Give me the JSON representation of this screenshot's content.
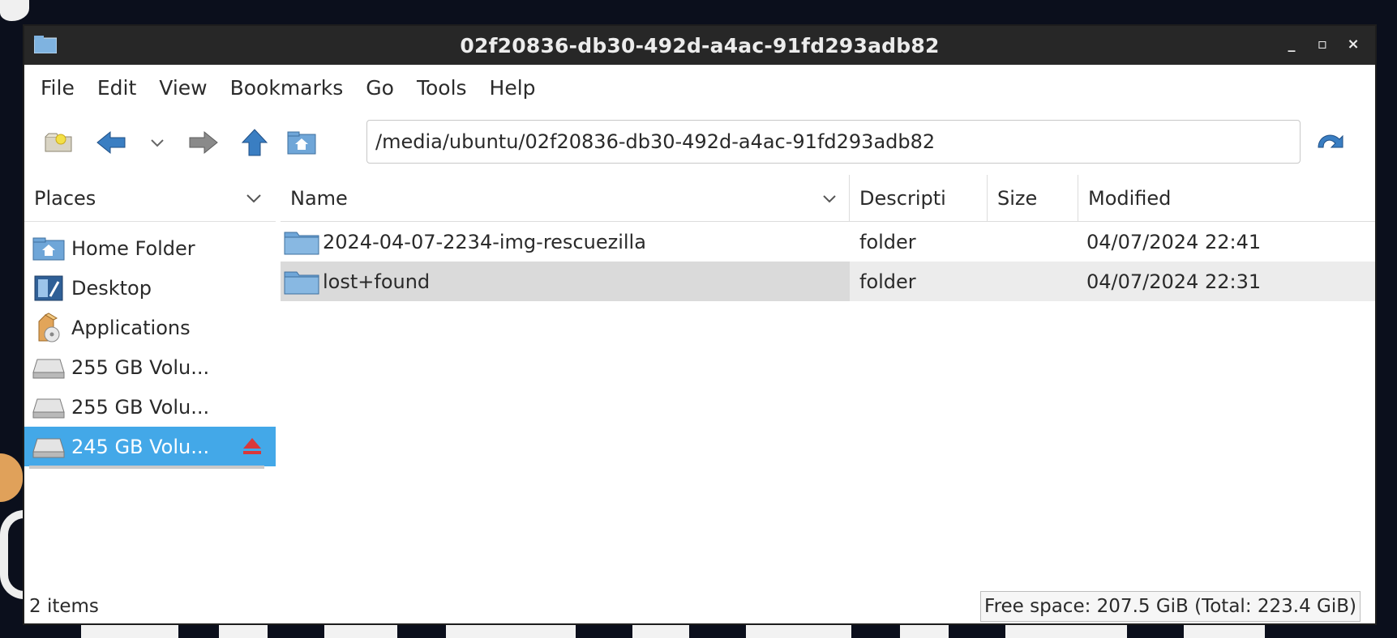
{
  "window": {
    "title": "02f20836-db30-492d-a4ac-91fd293adb82",
    "controls": {
      "minimize": "_",
      "maximize": "▫",
      "close": "×"
    }
  },
  "menu": [
    "File",
    "Edit",
    "View",
    "Bookmarks",
    "Go",
    "Tools",
    "Help"
  ],
  "toolbar": {
    "icons": [
      "new-tab-icon",
      "back-icon",
      "history-dropdown-icon",
      "forward-icon",
      "up-icon",
      "home-icon",
      "reload-icon"
    ],
    "path_value": "/media/ubuntu/02f20836-db30-492d-a4ac-91fd293adb82"
  },
  "places": {
    "header": "Places",
    "items": [
      {
        "label": "Home Folder",
        "icon": "home-folder-icon"
      },
      {
        "label": "Desktop",
        "icon": "desktop-icon"
      },
      {
        "label": "Applications",
        "icon": "applications-icon"
      },
      {
        "label": "255 GB Volu...",
        "icon": "drive-icon"
      },
      {
        "label": "255 GB Volu...",
        "icon": "drive-icon"
      },
      {
        "label": "245 GB Volu...",
        "icon": "drive-icon",
        "selected": true
      }
    ]
  },
  "files": {
    "columns": {
      "name": "Name",
      "description": "Descripti",
      "size": "Size",
      "modified": "Modified"
    },
    "rows": [
      {
        "name": "2024-04-07-2234-img-rescuezilla",
        "description": "folder",
        "size": "",
        "modified": "04/07/2024 22:41"
      },
      {
        "name": "lost+found",
        "description": "folder",
        "size": "",
        "modified": "04/07/2024 22:31"
      }
    ]
  },
  "status": {
    "items": "2 items",
    "free_space": "Free space: 207.5 GiB (Total: 223.4 GiB)"
  },
  "colors": {
    "titlebar": "#272727",
    "selection": "#43a8e8",
    "folder": "#6fa6d8",
    "arrow": "#3a7ec2",
    "eject": "#d9383a"
  }
}
